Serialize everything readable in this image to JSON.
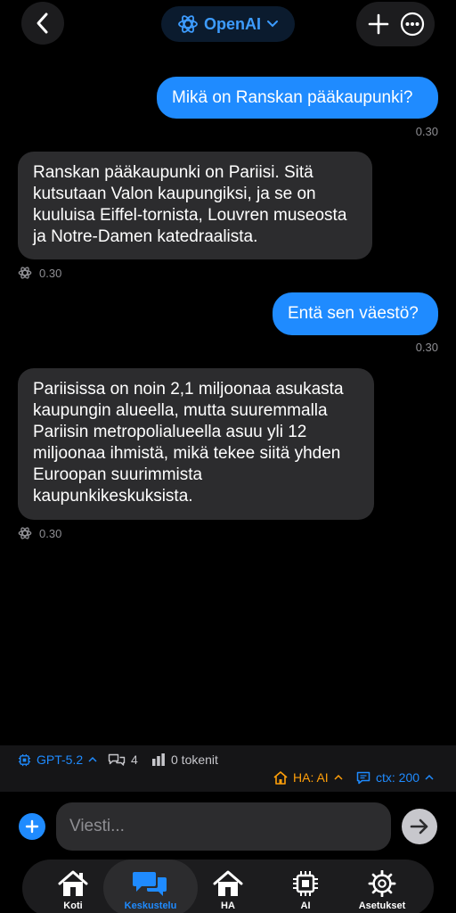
{
  "header": {
    "model_name": "OpenAI"
  },
  "messages": [
    {
      "role": "user",
      "text": "Mikä on Ranskan pääkaupunki?",
      "time": "0.30"
    },
    {
      "role": "assistant",
      "text": "Ranskan pääkaupunki on Pariisi. Sitä kutsutaan Valon kaupungiksi, ja se on kuuluisa Eiffel-tornista, Louvren museosta ja Notre-Damen katedraalista.",
      "time": "0.30"
    },
    {
      "role": "user",
      "text": "Entä sen väestö?",
      "time": "0.30"
    },
    {
      "role": "assistant",
      "text": "Pariisissa on noin 2,1 miljoonaa asukasta kaupungin alueella, mutta suuremmalla Pariisin metropolialueella asuu yli 12 miljoonaa ihmistä, mikä tekee siitä yhden Euroopan suurimmista kaupunkikeskuksista.",
      "time": "0.30"
    }
  ],
  "status": {
    "model": "GPT-5.2",
    "chats": "4",
    "tokens": "0 tokenit",
    "ha": "HA: AI",
    "ctx": "ctx: 200"
  },
  "composer": {
    "placeholder": "Viesti..."
  },
  "tabs": [
    {
      "label": "Koti"
    },
    {
      "label": "Keskustelu"
    },
    {
      "label": "HA"
    },
    {
      "label": "AI"
    },
    {
      "label": "Asetukset"
    }
  ],
  "colors": {
    "accent": "#1f8bff",
    "orange": "#ff9f0a",
    "bubble_ai": "#2c2c2e"
  }
}
